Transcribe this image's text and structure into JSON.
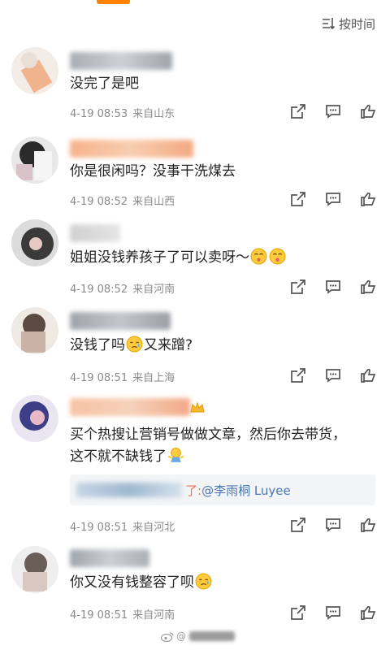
{
  "header": {
    "sort_label": "按时间",
    "accent_color": "#ff8200"
  },
  "comments": [
    {
      "text": "没完了是吧",
      "date": "4-19 08:53",
      "location": "来自山东"
    },
    {
      "text": "你是很闲吗？没事干洗煤去",
      "date": "4-19 08:52",
      "location": "来自山西"
    },
    {
      "text": "姐姐没钱养孩子了可以卖呀～",
      "emoji": [
        "kiss-face-icon",
        "kiss-face-icon"
      ],
      "date": "4-19 08:52",
      "location": "来自河南"
    },
    {
      "text_before": "没钱了吗",
      "text_after": "又来蹭?",
      "emoji": [
        "tearful-face-icon"
      ],
      "date": "4-19 08:51",
      "location": "来自上海"
    },
    {
      "text_line1": "买个热搜让营销号做做文章，然后你去带货，",
      "text_line2": "这不就不缺钱了",
      "emoji": [
        "shrug-icon"
      ],
      "reply_suffix": "了:",
      "reply_mention": "@李雨桐 Luyee",
      "date": "4-19 08:51",
      "location": "来自河北"
    },
    {
      "text": "你又没有钱整容了呗",
      "emoji": [
        "tearful-face-icon"
      ],
      "date": "4-19 08:51",
      "location": "来自河南"
    }
  ],
  "watermark": {
    "prefix": "@"
  }
}
